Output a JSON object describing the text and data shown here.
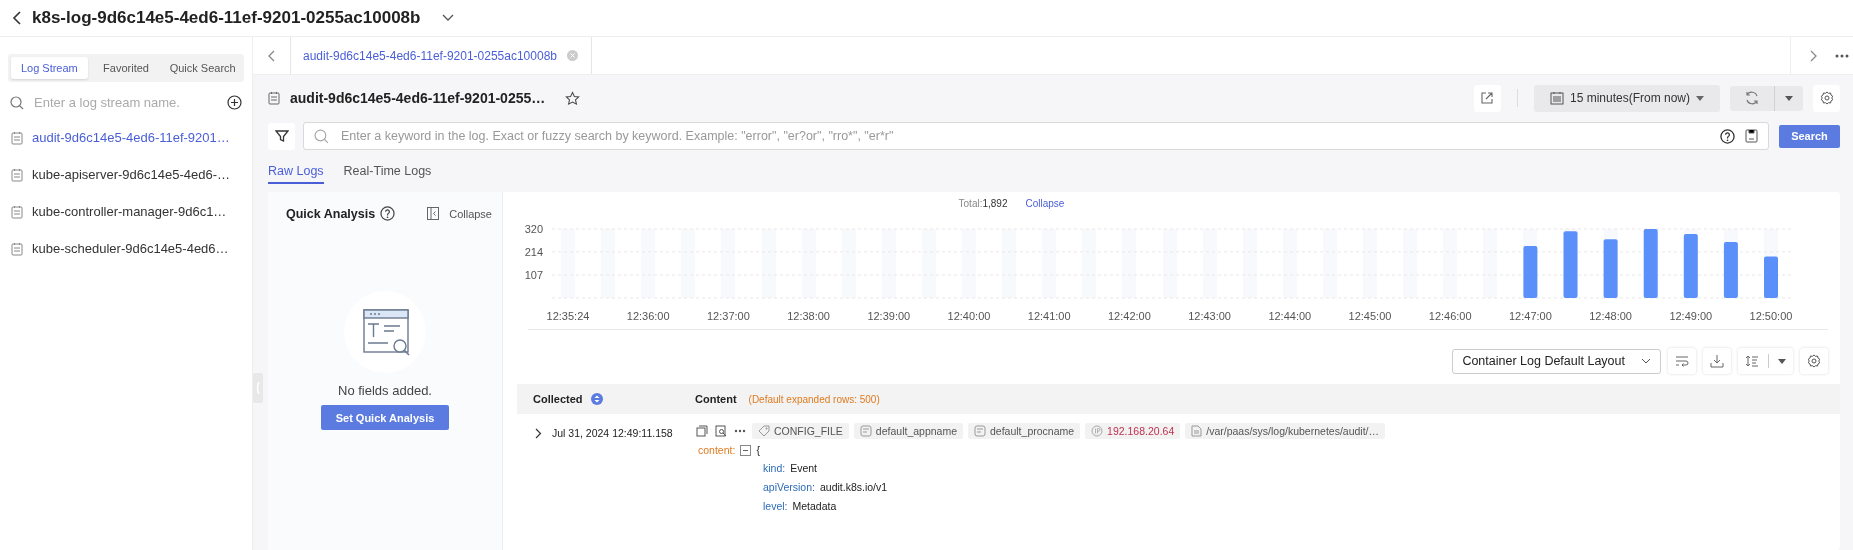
{
  "header": {
    "title": "k8s-log-9d6c14e5-4ed6-11ef-9201-0255ac10008b"
  },
  "sidebar": {
    "tabs": [
      {
        "label": "Log Stream",
        "selected": true
      },
      {
        "label": "Favorited",
        "selected": false
      },
      {
        "label": "Quick Search",
        "selected": false
      }
    ],
    "search": {
      "placeholder": "Enter a log stream name."
    },
    "items": [
      {
        "label": "audit-9d6c14e5-4ed6-11ef-9201…",
        "selected": true
      },
      {
        "label": "kube-apiserver-9d6c14e5-4ed6-…",
        "selected": false
      },
      {
        "label": "kube-controller-manager-9d6c1…",
        "selected": false
      },
      {
        "label": "kube-scheduler-9d6c14e5-4ed6…",
        "selected": false
      }
    ]
  },
  "tabs": [
    {
      "label": "audit-9d6c14e5-4ed6-11ef-9201-0255ac10008b",
      "selected": true
    }
  ],
  "stream": {
    "title": "audit-9d6c14e5-4ed6-11ef-9201-0255…",
    "time_range": "15 minutes(From now)"
  },
  "search": {
    "placeholder": "Enter a keyword in the log. Exact or fuzzy search by keyword. Example: \"error\", \"er?or\", \"rro*\", \"er*r\"",
    "button": "Search"
  },
  "view_tabs": [
    {
      "label": "Raw Logs",
      "selected": true
    },
    {
      "label": "Real-Time Logs",
      "selected": false
    }
  ],
  "quick_analysis": {
    "title": "Quick Analysis",
    "collapse": "Collapse",
    "empty": "No fields added.",
    "button": "Set Quick Analysis"
  },
  "histogram": {
    "total_label": "Total:",
    "total": "1,892",
    "collapse": "Collapse",
    "chart_data": {
      "type": "bar",
      "categories": [
        "12:35:24",
        null,
        "12:36:00",
        null,
        "12:37:00",
        null,
        "12:38:00",
        null,
        "12:39:00",
        null,
        "12:40:00",
        null,
        "12:41:00",
        null,
        "12:42:00",
        null,
        "12:43:00",
        null,
        "12:44:00",
        null,
        "12:45:00",
        null,
        "12:46:00",
        null,
        "12:47:00",
        null,
        "12:48:00",
        null,
        "12:49:00",
        null,
        "12:50:00"
      ],
      "series": [
        {
          "color": "#5b8ff9",
          "values": [
            0,
            0,
            0,
            0,
            0,
            0,
            0,
            0,
            0,
            0,
            0,
            0,
            0,
            0,
            0,
            0,
            0,
            0,
            0,
            0,
            0,
            0,
            0,
            0,
            241,
            309,
            272,
            320,
            297,
            260,
            193
          ]
        }
      ],
      "ylim": [
        0,
        320
      ],
      "yticks": [
        107,
        214,
        320
      ]
    }
  },
  "layout_select": "Container Log Default Layout",
  "table": {
    "columns": [
      {
        "label": "Collected"
      },
      {
        "label": "Content",
        "note": "(Default expanded rows: 500)"
      }
    ],
    "rows": [
      {
        "time": "Jul 31, 2024 12:49:11.158",
        "tags": [
          {
            "kind": "config",
            "text": "CONFIG_FILE"
          },
          {
            "kind": "app",
            "text": "default_appname"
          },
          {
            "kind": "proc",
            "text": "default_procname"
          },
          {
            "kind": "ip",
            "text": "192.168.20.64"
          },
          {
            "kind": "file",
            "text": "/var/paas/sys/log/kubernetes/audit/…"
          }
        ],
        "content_key": "content:",
        "content_open": "{",
        "fields": [
          {
            "key": "kind:",
            "value": "Event"
          },
          {
            "key": "apiVersion:",
            "value": "audit.k8s.io/v1"
          },
          {
            "key": "level:",
            "value": "Metadata"
          }
        ]
      }
    ]
  }
}
